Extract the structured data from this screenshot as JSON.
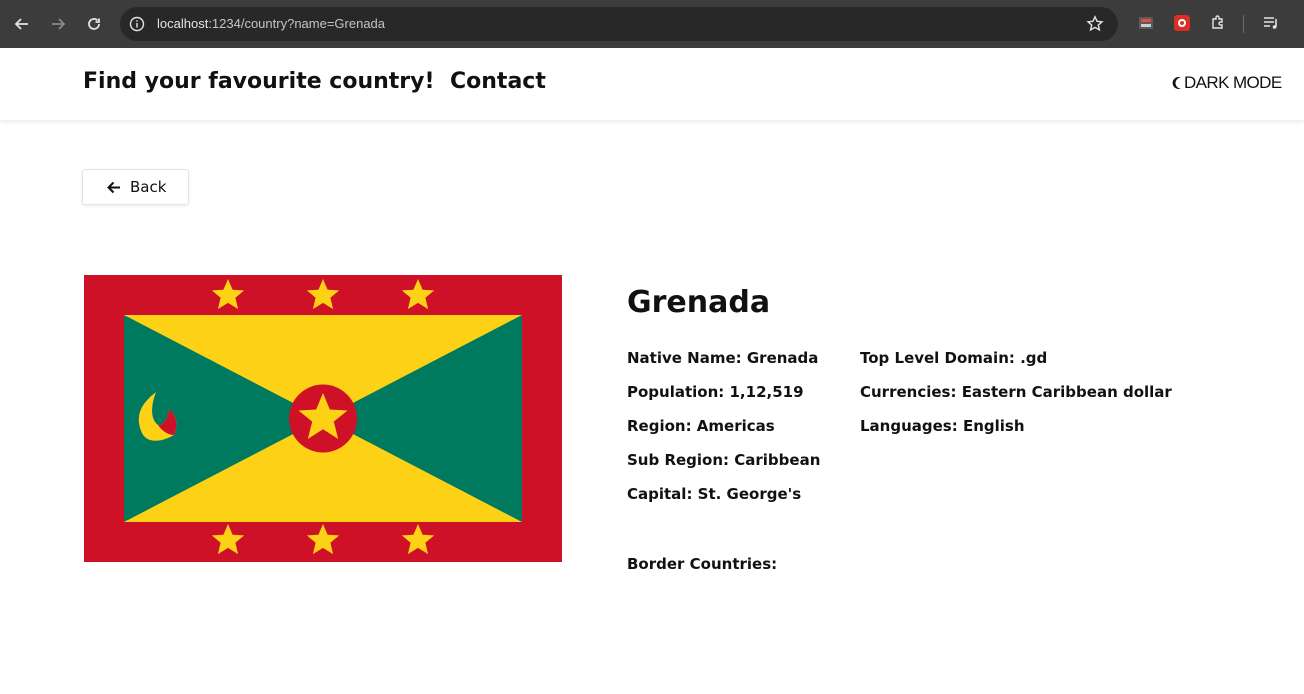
{
  "browser": {
    "url_host": "localhost",
    "url_path": ":1234/country?name=Grenada"
  },
  "header": {
    "brand": "Find your favourite country!",
    "contact": "Contact",
    "dark_mode": "DARK MODE"
  },
  "back_button": {
    "label": "Back"
  },
  "country": {
    "name": "Grenada",
    "native_name": "Native Name: Grenada",
    "population": "Population: 1,12,519",
    "region": "Region: Americas",
    "sub_region": "Sub Region: Caribbean",
    "capital": "Capital: St. George's",
    "top_level_domain": "Top Level Domain: .gd",
    "currencies": "Currencies: Eastern Caribbean dollar",
    "languages": "Languages: English",
    "border_countries": "Border Countries:"
  },
  "colors": {
    "chrome_bg": "#3c3c3c",
    "flag_red": "#ce1126",
    "flag_yellow": "#fcd116",
    "flag_green": "#007a5e"
  }
}
